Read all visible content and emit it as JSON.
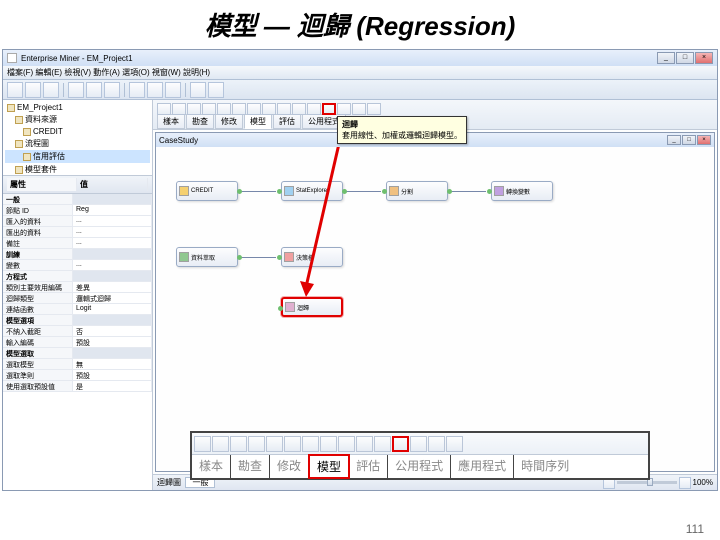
{
  "slide": {
    "title": "模型 — 迴歸 (Regression)",
    "page_number": "111"
  },
  "app": {
    "title": "Enterprise Miner - EM_Project1"
  },
  "menu": {
    "items": "檔案(F) 編輯(E) 檢視(V) 動作(A) 選項(O) 視窗(W) 說明(H)"
  },
  "tree": {
    "root": "EM_Project1",
    "items": [
      {
        "label": "資料來源",
        "indent": 1,
        "icon": true
      },
      {
        "label": "CREDIT",
        "indent": 2,
        "icon": true
      },
      {
        "label": "流程圖",
        "indent": 1,
        "icon": true
      },
      {
        "label": "信用評估",
        "indent": 2,
        "icon": true,
        "selected": true
      },
      {
        "label": "模型套件",
        "indent": 1,
        "icon": true
      }
    ]
  },
  "props": {
    "title": "屬性",
    "col1": "屬性",
    "col2": "值",
    "rows": [
      {
        "k": "一般",
        "v": "",
        "hdr": true
      },
      {
        "k": "節點 ID",
        "v": "Reg"
      },
      {
        "k": "匯入的資料",
        "v": "..."
      },
      {
        "k": "匯出的資料",
        "v": "..."
      },
      {
        "k": "備註",
        "v": "..."
      },
      {
        "k": "訓練",
        "v": "",
        "hdr": true
      },
      {
        "k": "變數",
        "v": "..."
      },
      {
        "k": "方程式",
        "v": "",
        "hdr": true
      },
      {
        "k": "類別主要效用編碼",
        "v": "差異"
      },
      {
        "k": "迴歸類型",
        "v": "邏輯式迴歸"
      },
      {
        "k": "連結函數",
        "v": "Logit"
      },
      {
        "k": "模型選項",
        "v": "",
        "hdr": true
      },
      {
        "k": "不納入截距",
        "v": "否"
      },
      {
        "k": "輸入編碼",
        "v": "預設"
      },
      {
        "k": "模型選取",
        "v": "",
        "hdr": true
      },
      {
        "k": "選取模型",
        "v": "無"
      },
      {
        "k": "選取準則",
        "v": "預設"
      },
      {
        "k": "使用選取預設值",
        "v": "是"
      }
    ]
  },
  "node_tabs": [
    "樣本",
    "勘查",
    "修改",
    "模型",
    "評估",
    "公用程式"
  ],
  "tooltip": {
    "title": "迴歸",
    "body": "套用線性、加權或邏輯迴歸模型。"
  },
  "canvas": {
    "title": "CaseStudy",
    "nodes": {
      "n1": "CREDIT",
      "n2": "StatExplore",
      "n3": "分割",
      "n4": "轉換變數",
      "n5": "資料萃取",
      "n6": "決策樹",
      "n7": "迴歸"
    }
  },
  "categories": {
    "tabs": [
      "樣本",
      "勘查",
      "修改",
      "模型",
      "評估",
      "公用程式",
      "應用程式",
      "時間序列"
    ]
  },
  "status": {
    "left": "迴歸圖",
    "combo": "一般",
    "zoom": "100%"
  }
}
